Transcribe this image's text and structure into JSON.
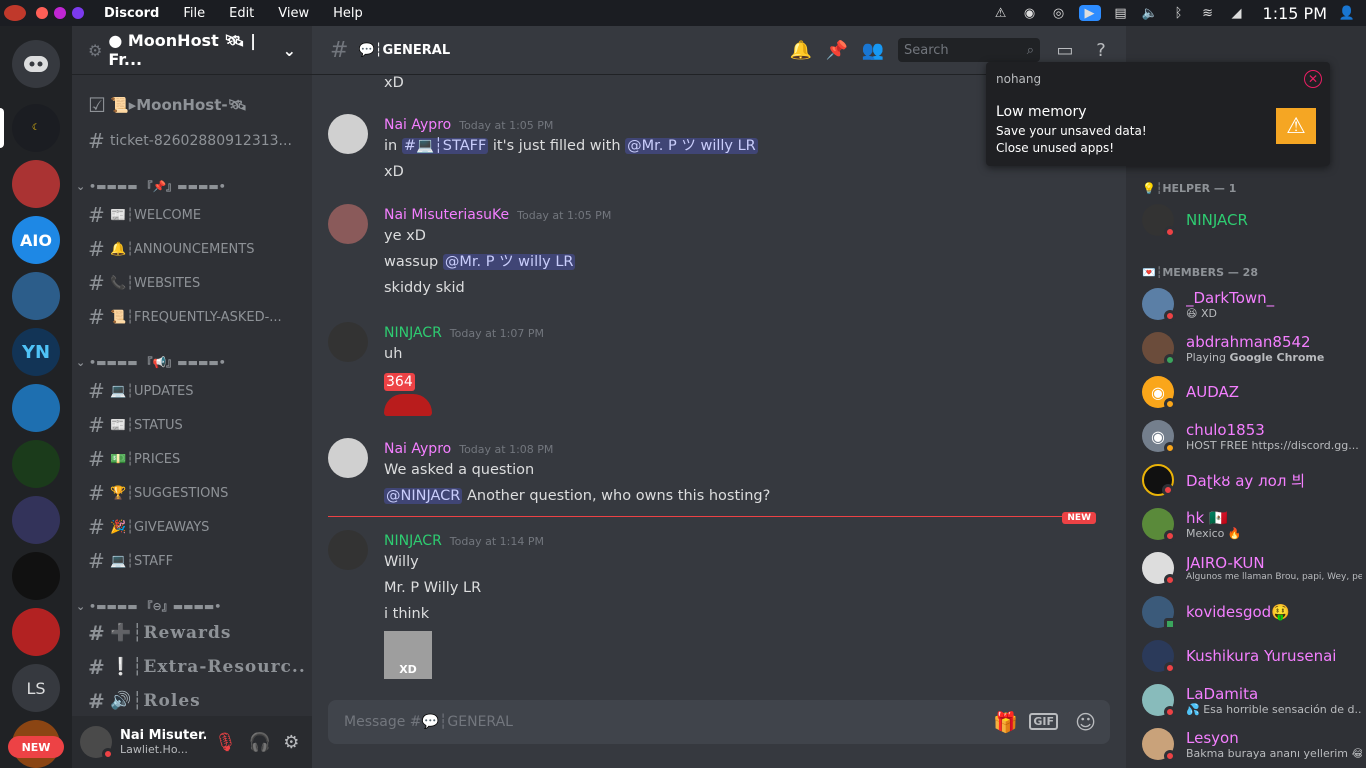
{
  "topbar": {
    "app": "Discord",
    "menus": [
      "File",
      "Edit",
      "View",
      "Help"
    ],
    "clock": "1:15 PM"
  },
  "servers": {
    "new_badge": "NEW",
    "ls_initials": "LS",
    "aio_label": "AIO",
    "yn_label": "YN"
  },
  "guild": {
    "name": "● MoonHost 🛰 | Fr...",
    "channels": [
      {
        "icon": "☑",
        "label": "📜▸MoonHost-🛰"
      },
      {
        "icon": "#",
        "label": "ticket-82602880912313..."
      }
    ],
    "cat1": "•▬▬▬▬ 『📌』▬▬▬▬•",
    "cat1_items": [
      "📰┆WELCOME",
      "🔔┆ANNOUNCEMENTS",
      "📞┆WEBSITES",
      "📜┆FREQUENTLY-ASKED-..."
    ],
    "cat2": "•▬▬▬▬ 『📢』▬▬▬▬•",
    "cat2_items": [
      "💻┆UPDATES",
      "📰┆STATUS",
      "💵┆PRICES",
      "🏆┆SUGGESTIONS",
      "🎉┆GIVEAWAYS",
      "💻┆STAFF"
    ],
    "cat3": "•▬▬▬▬ 『⊖』▬▬▬▬•",
    "cat3_items": [
      "➕┆Rewards",
      "❕┆Extra-Resourc...",
      "🔊┆Roles"
    ]
  },
  "user_panel": {
    "name": "Nai Misuter...",
    "status": "Lawliet.Ho..."
  },
  "channel": {
    "name": "💬┆GENERAL",
    "search_placeholder": "Search",
    "composer_placeholder": "Message #💬┆GENERAL"
  },
  "messages": [
    {
      "lines": [
        "xD"
      ]
    },
    {
      "author": "Nai Aypro",
      "time": "Today at 1:05 PM",
      "color": "#f47fff",
      "pre": "in ",
      "mention": "#💻┆STAFF",
      "post": " it's just filled with ",
      "mention2": "@Mr. P ツ willy LR",
      "line2": "xD"
    },
    {
      "author": "Nai MisuteriasuKe",
      "time": "Today at 1:05 PM",
      "color": "#f47fff",
      "line1": "ye xD",
      "line2_pre": "wassup ",
      "line2_mention": "@Mr. P ツ willy LR",
      "line3": "skiddy skid"
    },
    {
      "author": "NINJACR",
      "time": "Today at 1:07 PM",
      "color": "#2ecc71",
      "line1": "uh",
      "badge": "364"
    },
    {
      "author": "Nai Aypro",
      "time": "Today at 1:08 PM",
      "color": "#f47fff",
      "line1": "We asked a question",
      "mention": "@NINJACR",
      "line2": " Another question, who owns this hosting?"
    },
    {
      "author": "NINJACR",
      "time": "Today at 1:14 PM",
      "color": "#2ecc71",
      "line1": "Willy",
      "line2": "Mr. P Willy LR",
      "line3": "i think",
      "sticker": "XD"
    }
  ],
  "new_marker": "NEW",
  "popup": {
    "app": "nohang",
    "title": "Low memory",
    "line1": "Save your unsaved data!",
    "line2": "Close unused apps!"
  },
  "member_list": {
    "helper_cat": "💡┆HELPER — 1",
    "helper": {
      "name": "NINJACR",
      "color": "#2ecc71"
    },
    "members_cat": "💌┆MEMBERS — 28",
    "members": [
      {
        "name": "_DarkTown_",
        "status": "😆 XD"
      },
      {
        "name": "abdrahman8542",
        "status_pre": "Playing ",
        "status_bold": "Google Chrome"
      },
      {
        "name": "AUDAZ",
        "status": ""
      },
      {
        "name": "chulo1853",
        "status": "HOST FREE https://discord.gg..."
      },
      {
        "name": "Daʈkȣ ay лол 븨",
        "status": ""
      },
      {
        "name": "hk 🇲🇽",
        "status": "Mexico 🔥"
      },
      {
        "name": "JAIRO-KUN",
        "status": "Algunos me llaman Brou, papi, Wey, pero si..."
      },
      {
        "name": "kovidesgod🤑",
        "status": ""
      },
      {
        "name": "Kushikura Yurusenai",
        "status": ""
      },
      {
        "name": "LaDamita",
        "status": "💦 Esa horrible sensación de d..."
      },
      {
        "name": "Lesyon",
        "status": "Bakma buraya ananı yellerim 😂"
      }
    ]
  }
}
